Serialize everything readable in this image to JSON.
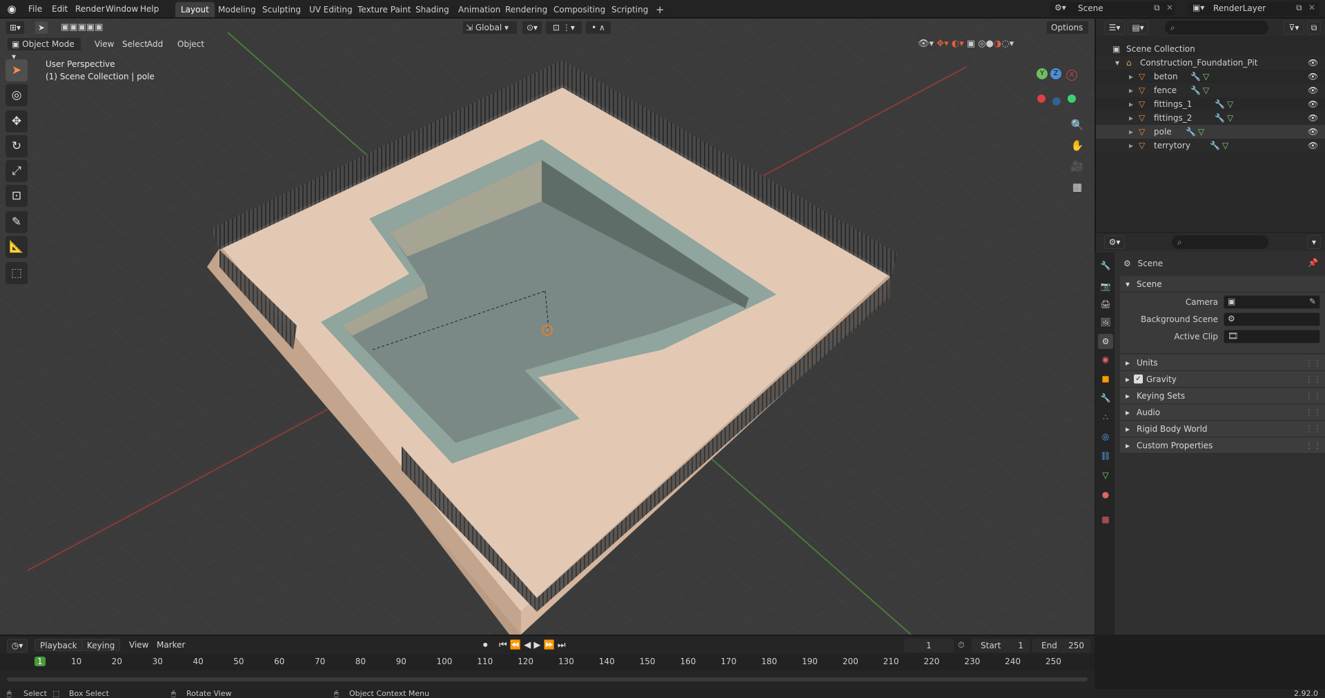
{
  "app": {
    "version": "2.92.0"
  },
  "topbar": {
    "menus": [
      "File",
      "Edit",
      "Render",
      "Window",
      "Help"
    ],
    "workspaces": [
      "Layout",
      "Modeling",
      "Sculpting",
      "UV Editing",
      "Texture Paint",
      "Shading",
      "Animation",
      "Rendering",
      "Compositing",
      "Scripting"
    ],
    "active_workspace": "Layout",
    "add_label": "+",
    "scene_name": "Scene",
    "layer_name": "RenderLayer"
  },
  "viewport": {
    "mode": "Object Mode",
    "menus": [
      "View",
      "Select",
      "Add",
      "Object"
    ],
    "transform_orientation": "Global",
    "options_label": "Options",
    "perspective_label": "User Perspective",
    "context_label": "(1) Scene Collection | pole",
    "gizmo_axes": {
      "x": "X",
      "y": "Y",
      "z": "Z"
    }
  },
  "outliner": {
    "root": "Scene Collection",
    "collection": "Construction_Foundation_Pit",
    "items": [
      "beton",
      "fence",
      "fittings_1",
      "fittings_2",
      "pole",
      "terrytory"
    ]
  },
  "properties": {
    "header": "Scene",
    "panel_title": "Scene",
    "fields": [
      {
        "label": "Camera"
      },
      {
        "label": "Background Scene"
      },
      {
        "label": "Active Clip"
      }
    ],
    "sections": [
      "Units",
      "Gravity",
      "Keying Sets",
      "Audio",
      "Rigid Body World",
      "Custom Properties"
    ],
    "gravity_checked": true
  },
  "timeline": {
    "menus": [
      "Playback",
      "Keying",
      "View",
      "Marker"
    ],
    "current_frame": "1",
    "start_label": "Start",
    "start": "1",
    "end_label": "End",
    "end": "250",
    "ticks": [
      "1",
      "10",
      "20",
      "30",
      "40",
      "50",
      "60",
      "70",
      "80",
      "90",
      "100",
      "110",
      "120",
      "130",
      "140",
      "150",
      "160",
      "170",
      "180",
      "190",
      "200",
      "210",
      "220",
      "230",
      "240",
      "250"
    ]
  },
  "statusbar": {
    "items": [
      "Select",
      "Box Select",
      "Rotate View",
      "Object Context Menu"
    ]
  }
}
